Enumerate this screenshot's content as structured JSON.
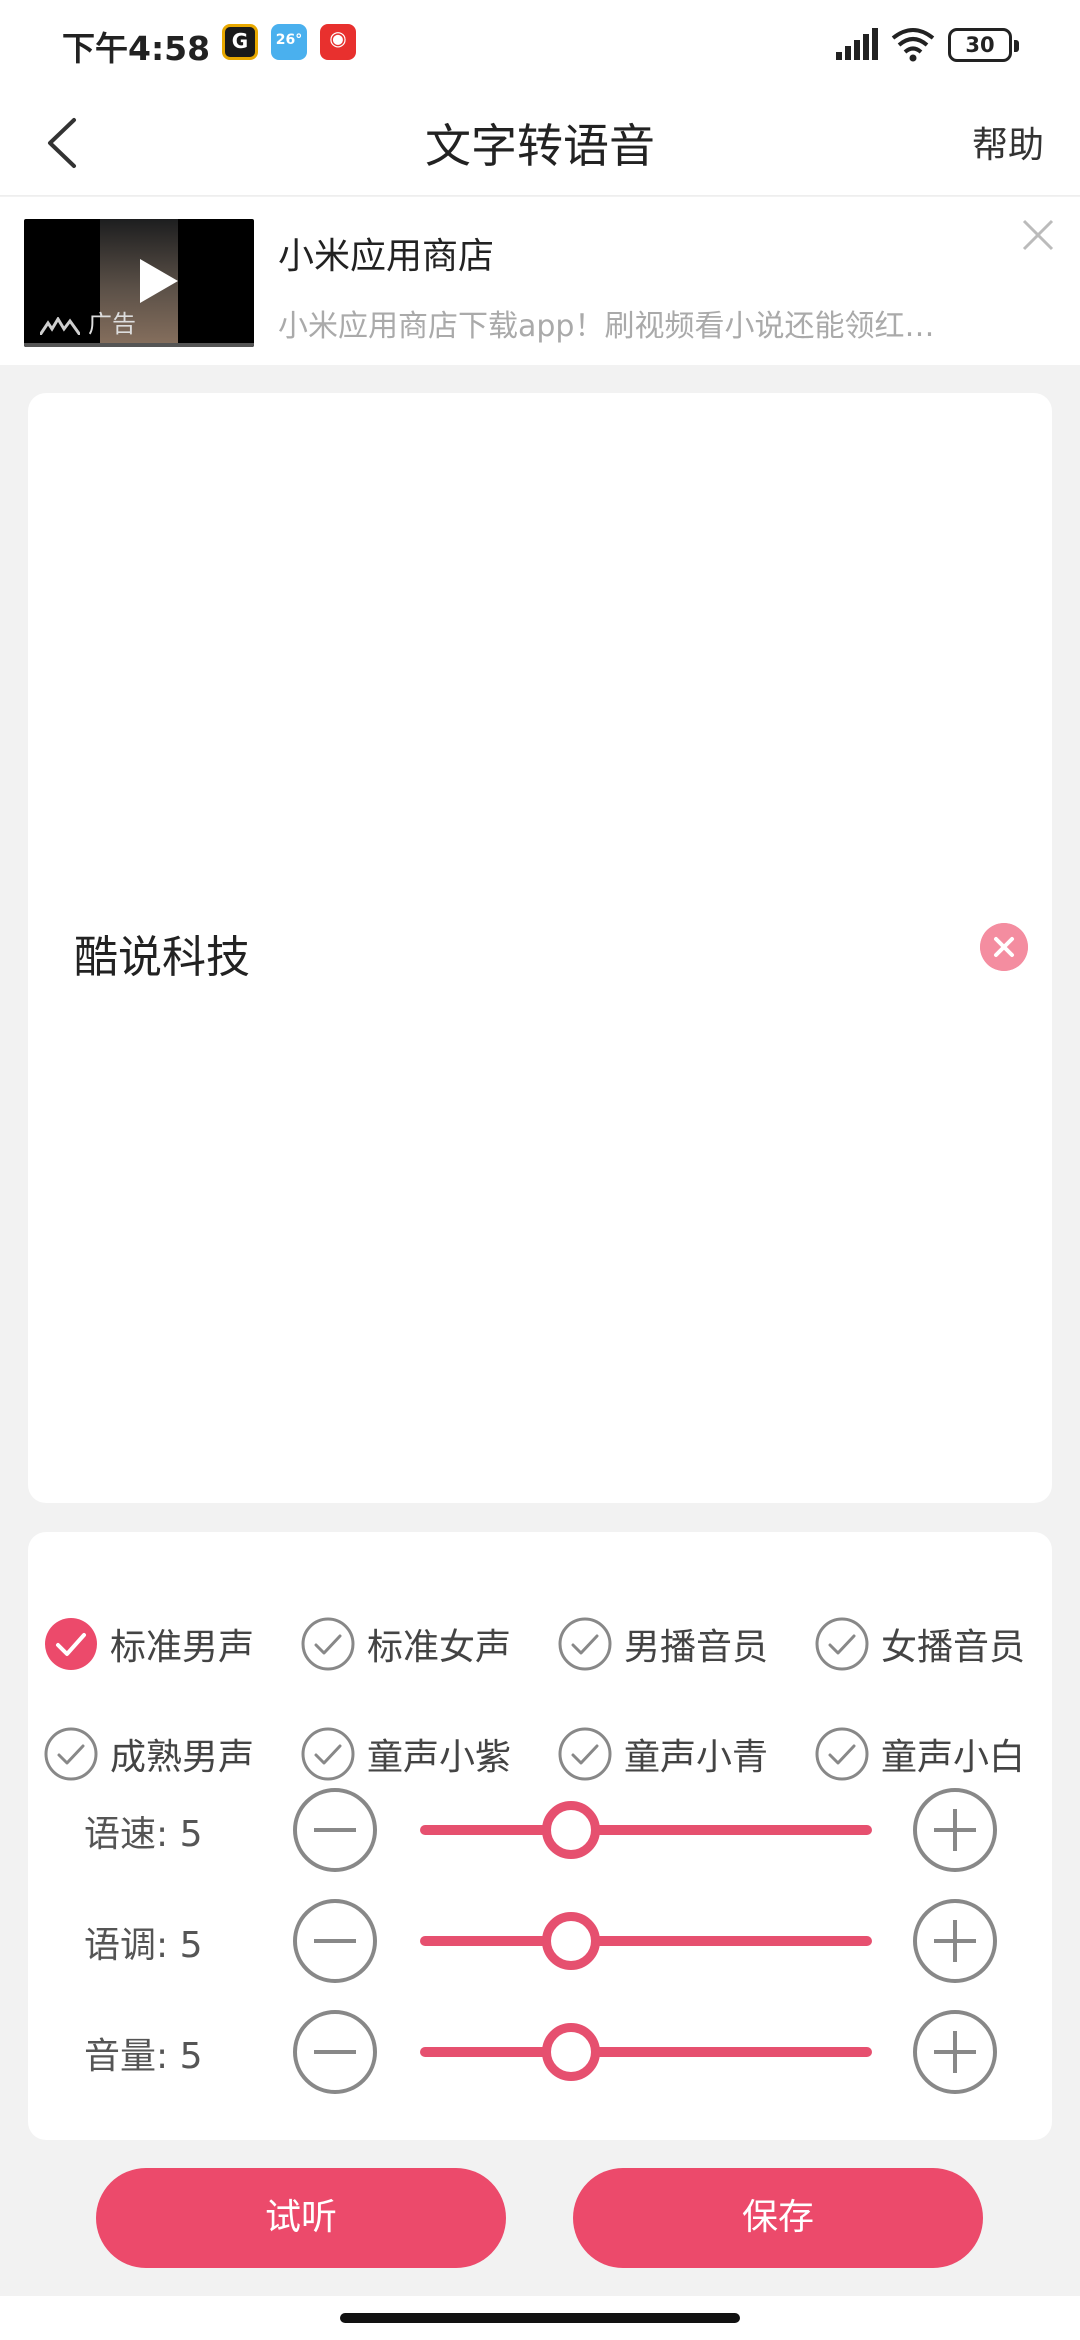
{
  "status_bar": {
    "time": "下午4:58",
    "app_icon_1": "G",
    "app_icon_2": "26°",
    "app_icon_3": "◉",
    "battery": "30"
  },
  "header": {
    "title": "文字转语音",
    "help": "帮助",
    "back_icon": "chevron-left-icon"
  },
  "ad": {
    "title": "小米应用商店",
    "description": "小米应用商店下载app！刷视频看小说还能领红…",
    "label": "广告"
  },
  "editor": {
    "text": "酷说科技"
  },
  "voices": [
    {
      "label": "标准男声",
      "selected": true
    },
    {
      "label": "标准女声",
      "selected": false
    },
    {
      "label": "男播音员",
      "selected": false
    },
    {
      "label": "女播音员",
      "selected": false
    },
    {
      "label": "成熟男声",
      "selected": false
    },
    {
      "label": "童声小紫",
      "selected": false
    },
    {
      "label": "童声小青",
      "selected": false
    },
    {
      "label": "童声小白",
      "selected": false
    }
  ],
  "params": [
    {
      "label": "语速: 5",
      "value": 5,
      "max": 15
    },
    {
      "label": "语调: 5",
      "value": 5,
      "max": 15
    },
    {
      "label": "音量: 5",
      "value": 5,
      "max": 15
    }
  ],
  "buttons": {
    "listen": "试听",
    "save": "保存"
  },
  "colors": {
    "accent": "#ec4a6b",
    "slider": "#e6506f",
    "clear": "#f48da0"
  }
}
